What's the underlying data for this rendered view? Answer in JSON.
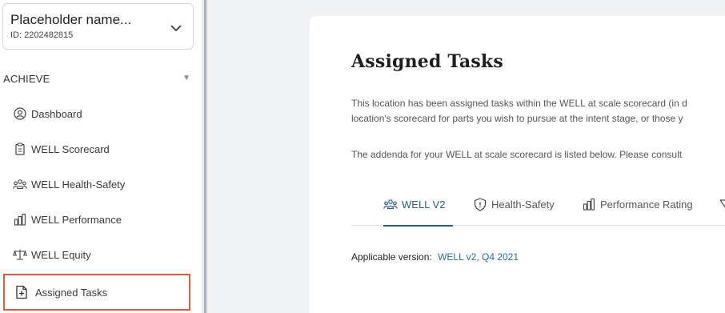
{
  "sidebar": {
    "project": {
      "name": "Placeholder name...",
      "id": "ID: 2202482815"
    },
    "section": {
      "label": "ACHIEVE"
    },
    "items": [
      {
        "label": "Dashboard",
        "icon": "dashboard-icon"
      },
      {
        "label": "WELL Scorecard",
        "icon": "clipboard-icon"
      },
      {
        "label": "WELL Health-Safety",
        "icon": "people-icon"
      },
      {
        "label": "WELL Performance",
        "icon": "bar-chart-icon"
      },
      {
        "label": "WELL Equity",
        "icon": "scales-icon"
      },
      {
        "label": "Assigned Tasks",
        "icon": "add-document-icon",
        "active": true
      }
    ]
  },
  "main": {
    "title": "Assigned Tasks",
    "paragraphs": [
      "This location has been assigned tasks within the WELL at scale scorecard (in d",
      "location's scorecard for parts you wish to pursue at the intent stage, or those y",
      "The addenda for your WELL at scale scorecard is listed below. Please consult"
    ],
    "tabs": [
      {
        "label": "WELL V2",
        "icon": "people-icon",
        "active": true
      },
      {
        "label": "Health-Safety",
        "icon": "shield-icon"
      },
      {
        "label": "Performance Rating",
        "icon": "bar-chart-icon"
      }
    ],
    "version": {
      "label": "Applicable version:",
      "value": "WELL v2, Q4 2021"
    }
  },
  "colors": {
    "accent": "#2a5f8c",
    "highlight": "#e05a3a",
    "background": "#f1f2f3"
  }
}
